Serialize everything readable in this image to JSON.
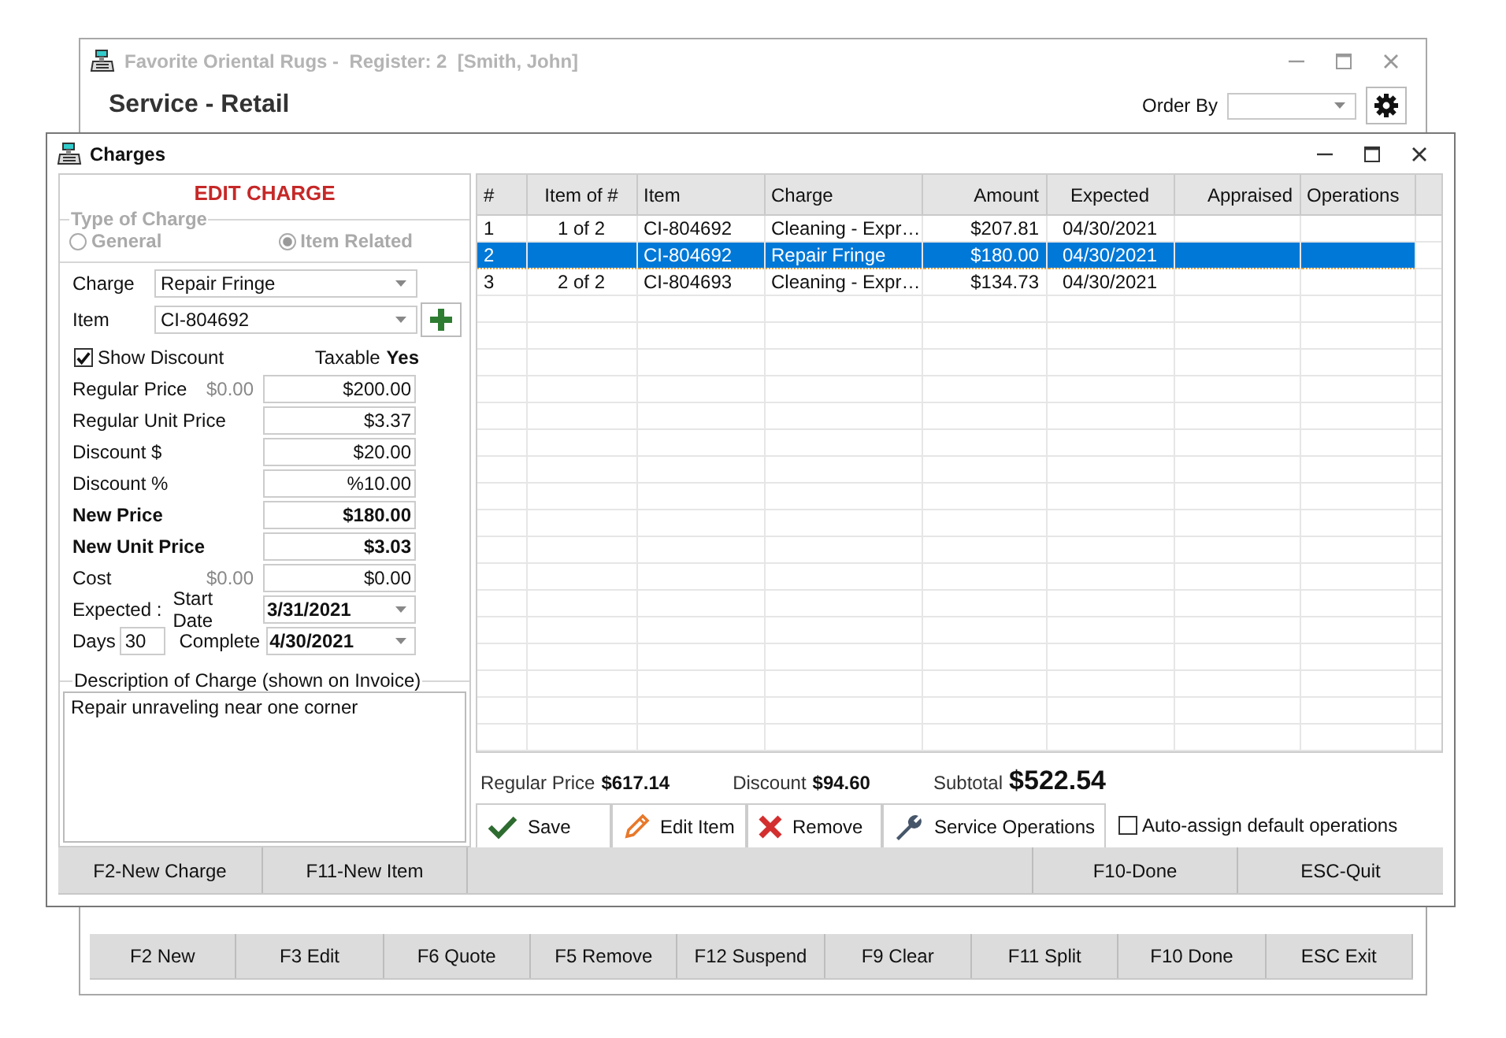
{
  "main_window": {
    "title": "Favorite Oriental Rugs -  Register: 2  [Smith, John]",
    "heading": "Service - Retail",
    "order_by_label": "Order By",
    "function_keys": [
      "F2 New",
      "F3 Edit",
      "F6 Quote",
      "F5 Remove",
      "F12 Suspend",
      "F9 Clear",
      "F11 Split",
      "F10 Done",
      "ESC Exit"
    ]
  },
  "dialog": {
    "title": "Charges",
    "form": {
      "heading": "EDIT CHARGE",
      "type_of_charge": {
        "label": "Type of Charge",
        "disabled": true,
        "options": [
          {
            "label": "General",
            "selected": false
          },
          {
            "label": "Item Related",
            "selected": true
          }
        ]
      },
      "charge": {
        "label": "Charge",
        "value": "Repair Fringe"
      },
      "item": {
        "label": "Item",
        "value": "CI-804692"
      },
      "show_discount": {
        "label": "Show Discount",
        "checked": true
      },
      "taxable": {
        "label": "Taxable",
        "value": "Yes"
      },
      "price_rows": [
        {
          "label": "Regular Price",
          "reference": "$0.00",
          "value": "$200.00",
          "bold": false
        },
        {
          "label": "Regular Unit Price",
          "value": "$3.37",
          "bold": false
        },
        {
          "label": "Discount $",
          "value": "$20.00",
          "bold": false
        },
        {
          "label": "Discount %",
          "value": "%10.00",
          "bold": false
        },
        {
          "label": "New Price",
          "value": "$180.00",
          "bold": true
        },
        {
          "label": "New Unit Price",
          "value": "$3.03",
          "bold": true
        },
        {
          "label": "Cost",
          "reference": "$0.00",
          "value": "$0.00",
          "bold": false
        }
      ],
      "expected": {
        "label": "Expected :",
        "start_label": "Start Date",
        "start_value": "3/31/2021",
        "days_label": "Days",
        "days_value": "30",
        "complete_label": "Complete",
        "complete_value": "4/30/2021"
      },
      "description": {
        "label": "Description of Charge (shown on Invoice)",
        "value": "Repair unraveling near one corner"
      }
    },
    "grid": {
      "columns": [
        "#",
        "Item of #",
        "Item",
        "Charge",
        "Amount",
        "Expected",
        "Appraised",
        "Operations"
      ],
      "rows": [
        {
          "cells": [
            "1",
            "1 of 2",
            "CI-804692",
            "Cleaning - Expr…",
            "$207.81",
            "04/30/2021"
          ],
          "selected": false
        },
        {
          "cells": [
            "2",
            null,
            "CI-804692",
            "Repair Fringe",
            "$180.00",
            "04/30/2021"
          ],
          "selected": true
        },
        {
          "cells": [
            "3",
            "2 of 2",
            "CI-804693",
            "Cleaning - Expr…",
            "$134.73",
            "04/30/2021"
          ],
          "selected": false
        }
      ]
    },
    "totals": [
      {
        "label": "Regular Price",
        "value": "$617.14"
      },
      {
        "label": "Discount",
        "value": "$94.60"
      },
      {
        "label": "Subtotal",
        "value": "$522.54"
      }
    ],
    "actions": [
      {
        "label": "Save",
        "kind": "save"
      },
      {
        "label": "Edit Item",
        "kind": "edit"
      },
      {
        "label": "Remove",
        "kind": "remove"
      },
      {
        "label": "Service Operations",
        "kind": "operations"
      }
    ],
    "auto_assign": {
      "label": "Auto-assign default operations",
      "checked": false
    },
    "function_keys_left": [
      "F2-New Charge",
      "F11-New Item"
    ],
    "function_keys_right": [
      "F10-Done",
      "ESC-Quit"
    ]
  }
}
